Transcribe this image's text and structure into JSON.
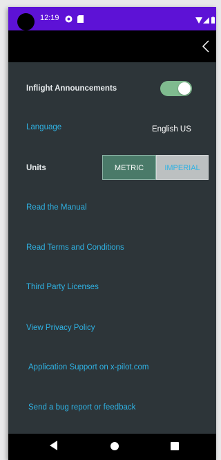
{
  "status_bar": {
    "time": "12:19",
    "icons_left": [
      "cast-icon",
      "sim-card-icon"
    ],
    "icons_right": [
      "wifi-icon",
      "signal-icon",
      "battery-icon"
    ],
    "background": "#5d12d6"
  },
  "app_bar": {
    "back_icon": "chevron-left-icon"
  },
  "settings": {
    "inflight_announcements": {
      "label": "Inflight Announcements",
      "enabled": true
    },
    "language": {
      "label": "Language",
      "value": "English US"
    },
    "units": {
      "label": "Units",
      "options": [
        "METRIC",
        "IMPERIAL"
      ],
      "selected": "METRIC"
    },
    "links": [
      {
        "label": "Read the Manual"
      },
      {
        "label": "Read Terms and Conditions"
      },
      {
        "label": "Third Party Licenses"
      },
      {
        "label": "View Privacy Policy"
      },
      {
        "label": "Application Support on x-pilot.com"
      },
      {
        "label": "Send a bug report or feedback"
      }
    ]
  },
  "nav_bar": {
    "buttons": [
      "back-triangle-icon",
      "home-circle-icon",
      "recents-square-icon"
    ]
  },
  "colors": {
    "background": "#2d3539",
    "link": "#2fb2e3",
    "toggle_on": "#7fbb8f",
    "segment_selected": "#4a7a69",
    "segment_unselected": "#bcc0c1"
  }
}
